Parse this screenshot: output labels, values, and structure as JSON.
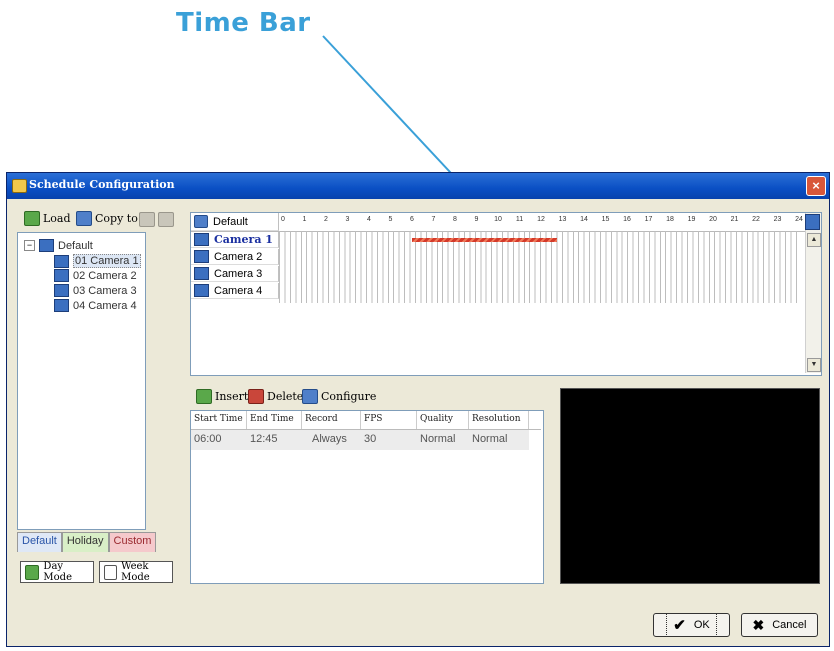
{
  "annotation": {
    "label": "Time Bar"
  },
  "window": {
    "title": "Schedule Configuration",
    "close_symbol": "×"
  },
  "left_toolbar": {
    "load_label": "Load",
    "copy_to_label": "Copy to"
  },
  "tree": {
    "root_label": "Default",
    "expander": "−",
    "cameras": [
      "01 Camera 1",
      "02 Camera 2",
      "03 Camera 3",
      "04 Camera 4"
    ]
  },
  "tabs": [
    "Default",
    "Holiday",
    "Custom"
  ],
  "modes": {
    "day_mode_label": "Day Mode",
    "week_mode_label": "Week Mode"
  },
  "timebar": {
    "header_label": "Default",
    "hours": [
      "0",
      "1",
      "2",
      "3",
      "4",
      "5",
      "6",
      "7",
      "8",
      "9",
      "10",
      "11",
      "12",
      "13",
      "14",
      "15",
      "16",
      "17",
      "18",
      "19",
      "20",
      "21",
      "22",
      "23",
      "24"
    ],
    "rows": [
      "Camera 1",
      "Camera 2",
      "Camera 3",
      "Camera 4"
    ],
    "selected_row": "Camera 1",
    "schedule_bar": {
      "camera": "Camera 1",
      "start_hour": 6.0,
      "end_hour": 12.75
    }
  },
  "table_toolbar": {
    "insert_label": "Insert",
    "delete_label": "Delete",
    "configure_label": "Configure"
  },
  "table": {
    "columns": [
      "Start Time",
      "End Time",
      "Record",
      "FPS",
      "Quality",
      "Resolution"
    ],
    "rows": [
      [
        "06:00",
        "12:45",
        "Always",
        "30",
        "Normal",
        "Normal"
      ]
    ]
  },
  "buttons": {
    "ok_label": "OK",
    "cancel_label": "Cancel"
  },
  "colors": {
    "title_bar": "#0a4fc4",
    "annotation": "#3aa0d8",
    "schedule_bar": "#d43a2a"
  }
}
